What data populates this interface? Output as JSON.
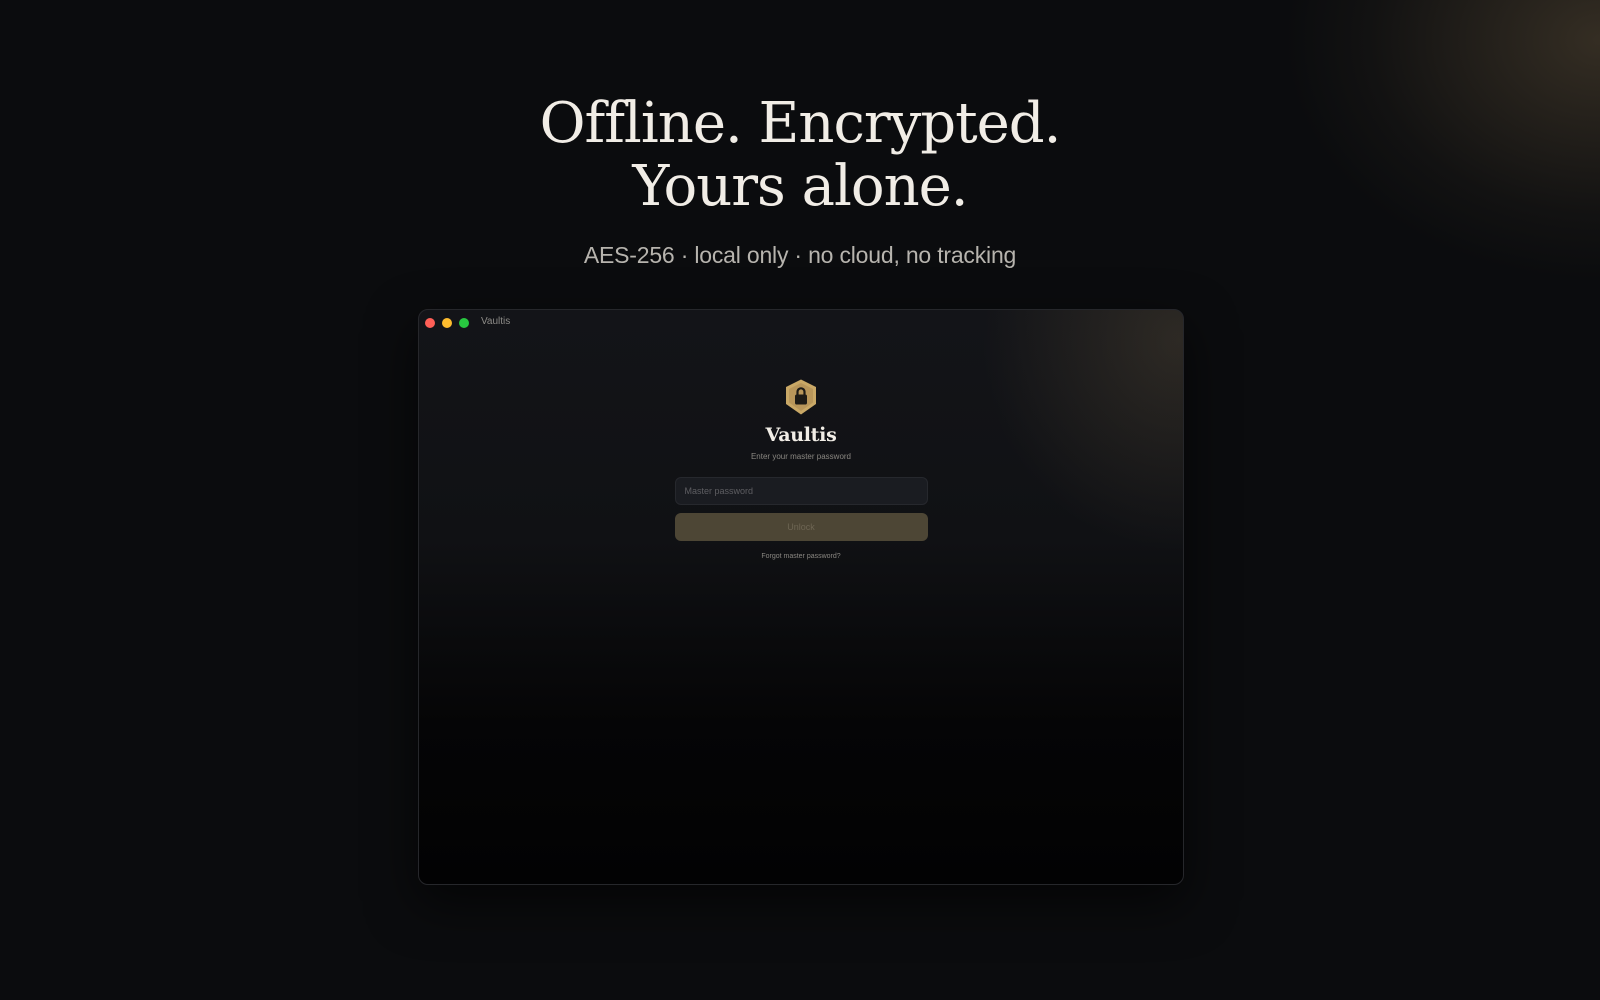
{
  "hero": {
    "title_line1": "Offline. Encrypted.",
    "title_line2": "Yours alone.",
    "subtitle": "AES-256 · local only · no cloud, no tracking"
  },
  "window": {
    "title": "Vaultis",
    "controls": [
      "close",
      "minimize",
      "zoom"
    ]
  },
  "login": {
    "logo_icon": "shield-lock-icon",
    "app_name": "Vaultis",
    "prompt": "Enter your master password",
    "password_placeholder": "Master password",
    "password_value": "",
    "unlock_label": "Unlock",
    "forgot_label": "Forgot master password?"
  },
  "colors": {
    "background": "#0b0c0e",
    "accent_gold": "#c9a866",
    "button_disabled": "#4d4635",
    "traffic_close": "#ff5f57",
    "traffic_minimize": "#febc2e",
    "traffic_zoom": "#28c840"
  }
}
